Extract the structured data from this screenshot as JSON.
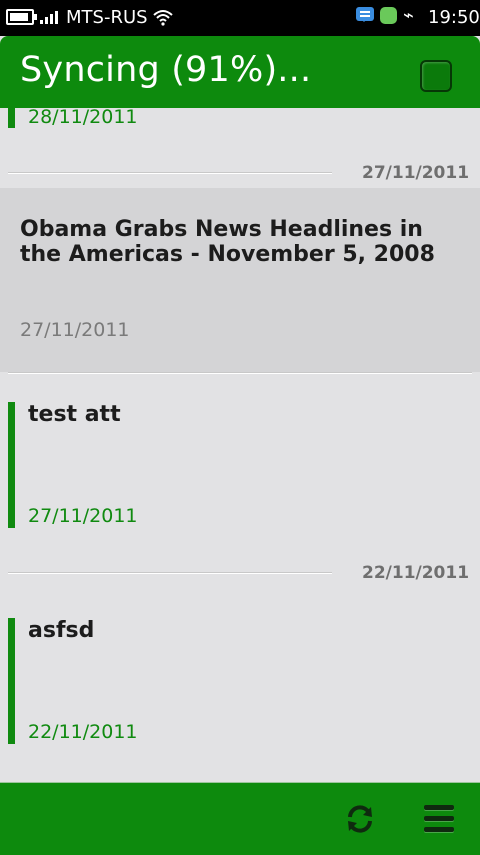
{
  "status_bar": {
    "carrier": "MTS-RUS",
    "time": "19:50",
    "icons": [
      "battery-icon",
      "signal-icon",
      "wifi-icon",
      "chat-icon",
      "green-app-icon",
      "usb-icon"
    ]
  },
  "header": {
    "title": "Syncing (91%)...",
    "sync_progress_percent": 91
  },
  "list": {
    "items": [
      {
        "title": "",
        "date": "28/11/2011",
        "read": false
      },
      {
        "section_date": "27/11/2011"
      },
      {
        "title": "Obama Grabs News Headlines in the Americas - November 5, 2008",
        "date": "27/11/2011",
        "read": true
      },
      {
        "title": "test att",
        "date": "27/11/2011",
        "read": false
      },
      {
        "section_date": "22/11/2011"
      },
      {
        "title": "asfsd",
        "date": "22/11/2011",
        "read": false
      }
    ]
  },
  "toolbar": {
    "icons": [
      "refresh-icon",
      "menu-icon"
    ]
  },
  "colors": {
    "accent_green": "#0d8a0d",
    "text_green": "#108a10",
    "list_bg": "#e2e2e4",
    "read_item_bg": "#d4d4d6"
  }
}
